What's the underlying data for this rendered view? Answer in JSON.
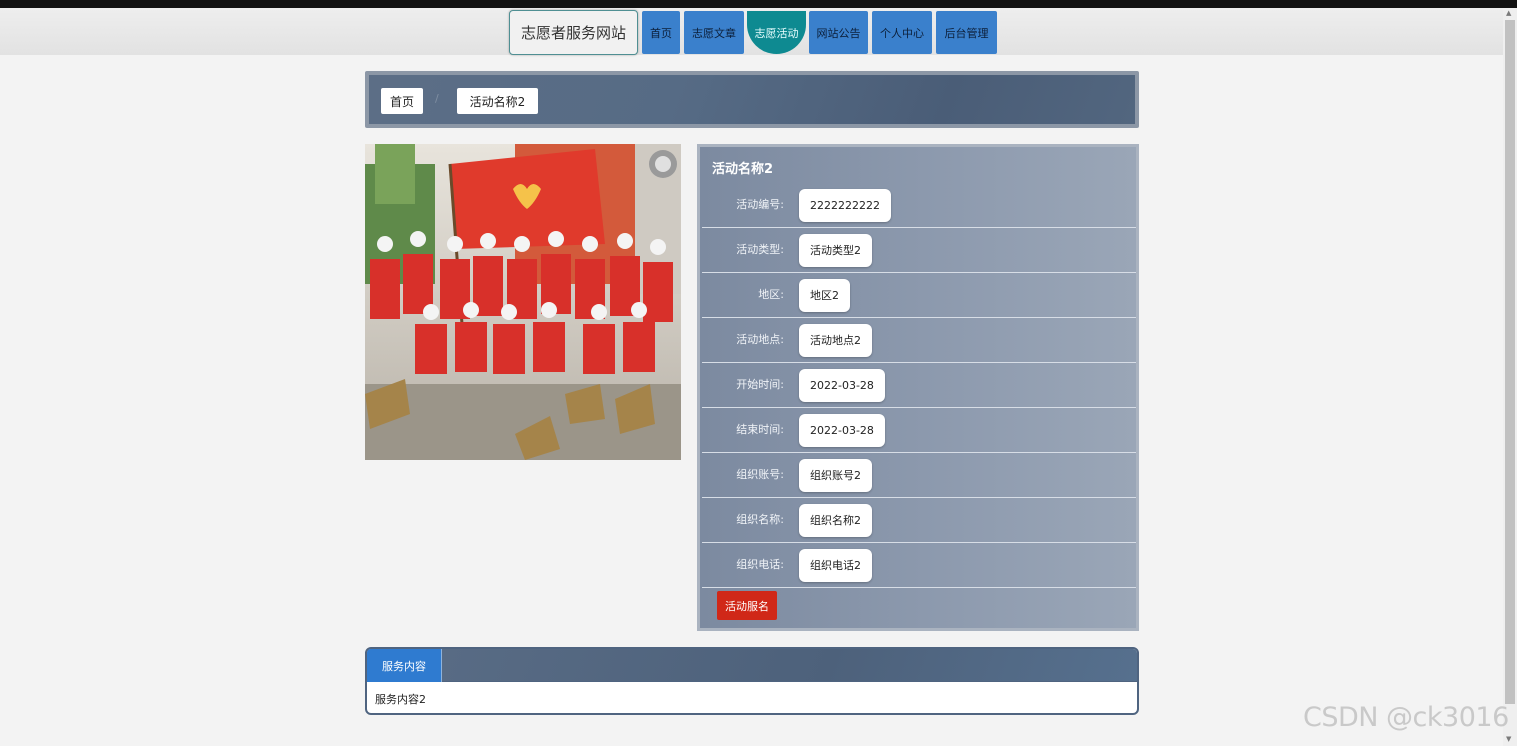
{
  "nav": {
    "brand": "志愿者服务网站",
    "items": [
      {
        "label": "首页"
      },
      {
        "label": "志愿文章"
      },
      {
        "label": "志愿活动",
        "active": true
      },
      {
        "label": "网站公告"
      },
      {
        "label": "个人中心"
      },
      {
        "label": "后台管理"
      }
    ]
  },
  "breadcrumb": {
    "home": "首页",
    "separator": "/",
    "current": "活动名称2"
  },
  "detail": {
    "title": "活动名称2",
    "fields": [
      {
        "label": "活动编号:",
        "value": "2222222222"
      },
      {
        "label": "活动类型:",
        "value": "活动类型2"
      },
      {
        "label": "地区:",
        "value": "地区2"
      },
      {
        "label": "活动地点:",
        "value": "活动地点2"
      },
      {
        "label": "开始时间:",
        "value": "2022-03-28"
      },
      {
        "label": "结束时间:",
        "value": "2022-03-28"
      },
      {
        "label": "组织账号:",
        "value": "组织账号2"
      },
      {
        "label": "组织名称:",
        "value": "组织名称2"
      },
      {
        "label": "组织电话:",
        "value": "组织电话2"
      }
    ],
    "signup_label": "活动服名"
  },
  "service": {
    "tab": "服务内容",
    "content": "服务内容2"
  },
  "watermark": "CSDN @ck3016",
  "colors": {
    "nav_button": "#3a80cc",
    "nav_active": "#0e8a91",
    "panel": "#8d9aae",
    "signup": "#d02818",
    "tab": "#2f7bd0"
  }
}
